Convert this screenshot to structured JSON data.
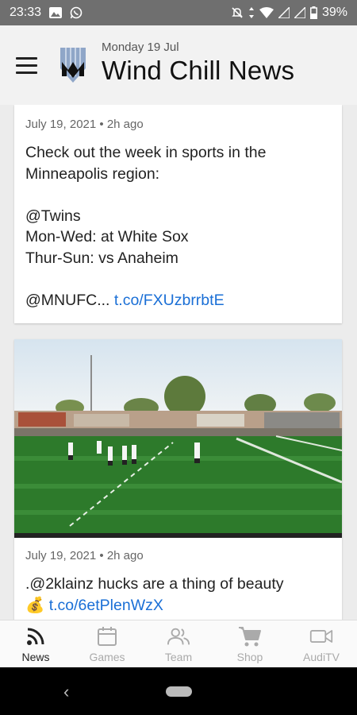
{
  "status_bar": {
    "time": "23:33",
    "battery": "39%"
  },
  "header": {
    "date": "Monday 19 Jul",
    "title": "Wind Chill News"
  },
  "feed": {
    "posts": [
      {
        "meta": "July 19, 2021 • 2h ago",
        "text": "Check out the week in sports in the Minneapolis region:\n\n@Twins\nMon-Wed: at White Sox\nThur-Sun: vs Anaheim\n\n@MNUFC... ",
        "link": "t.co/FXUzbrrbtE"
      },
      {
        "meta": "July 19, 2021 • 2h ago",
        "text": ".@2klainz hucks are a thing of beauty",
        "emoji": "💰",
        "link": "t.co/6etPlenWzX"
      }
    ]
  },
  "bottom_nav": {
    "items": [
      {
        "label": "News",
        "icon": "rss-icon",
        "active": true
      },
      {
        "label": "Games",
        "icon": "calendar-icon"
      },
      {
        "label": "Team",
        "icon": "people-icon"
      },
      {
        "label": "Shop",
        "icon": "cart-icon"
      },
      {
        "label": "AudiTV",
        "icon": "video-camera-icon"
      }
    ]
  },
  "colors": {
    "link": "#1a6fd6",
    "status_bar": "#6f6f6f",
    "active_nav": "#222222",
    "inactive_nav": "#aaaaaa"
  }
}
